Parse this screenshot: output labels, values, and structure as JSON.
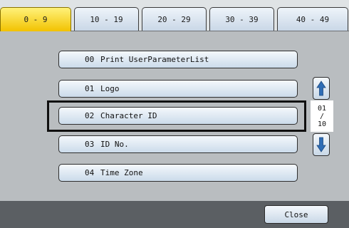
{
  "tabs": [
    {
      "label": "0 - 9",
      "active": true
    },
    {
      "label": "10 - 19",
      "active": false
    },
    {
      "label": "20 - 29",
      "active": false
    },
    {
      "label": "30 - 39",
      "active": false
    },
    {
      "label": "40 - 49",
      "active": false
    }
  ],
  "list": {
    "items": [
      {
        "code": "00",
        "label": "Print UserParameterList"
      },
      {
        "code": "01",
        "label": "Logo"
      },
      {
        "code": "02",
        "label": "Character ID",
        "selected": true
      },
      {
        "code": "03",
        "label": "ID No."
      },
      {
        "code": "04",
        "label": "Time Zone"
      }
    ]
  },
  "pager": {
    "current": "01",
    "separator": "/",
    "total": "10"
  },
  "icons": {
    "up": "arrow-up-icon",
    "down": "arrow-down-icon"
  },
  "footer": {
    "close_label": "Close"
  },
  "colors": {
    "active_tab": "#f2c200",
    "button": "#cbdbea",
    "arrow": "#2f6db5",
    "background": "#b9bdc0",
    "footer": "#5b5f63"
  }
}
